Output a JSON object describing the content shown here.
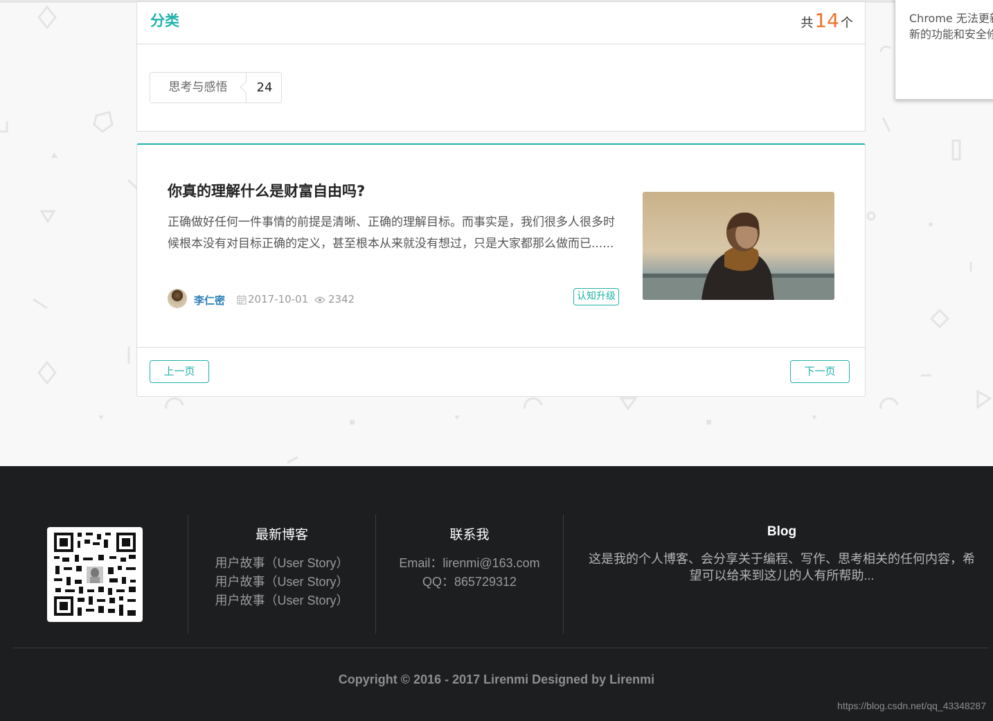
{
  "category": {
    "title": "分类",
    "count_prefix": "共",
    "count_value": "14",
    "count_suffix": "个",
    "tags": [
      {
        "label": "思考与感悟",
        "count": "24"
      }
    ]
  },
  "post": {
    "title": "你真的理解什么是财富自由吗?",
    "excerpt": "正确做好任何一件事情的前提是清晰、正确的理解目标。而事实是，我们很多人很多时候根本没有对目标正确的定义，甚至根本从来就没有想过，只是大家都那么做而已......",
    "author": "李仁密",
    "date": "2017-10-01",
    "views": "2342",
    "tag": "认知升级"
  },
  "pager": {
    "prev_label": "上一页",
    "next_label": "下一页"
  },
  "chrome_popup": {
    "line1": "Chrome 无法更新",
    "line2": "新的功能和安全修"
  },
  "footer": {
    "latest": {
      "heading": "最新博客",
      "items": [
        "用户故事（User Story）",
        "用户故事（User Story）",
        "用户故事（User Story）"
      ]
    },
    "contact": {
      "heading": "联系我",
      "email": "Email：lirenmi@163.com",
      "qq": "QQ：865729312"
    },
    "blog": {
      "heading": "Blog",
      "line1": "这是我的个人博客、会分享关于编程、写作、思考相关的任何内容，希",
      "line2": "望可以给来到这儿的人有所帮助..."
    },
    "copyright": "Copyright © 2016 - 2017 Lirenmi Designed by Lirenmi",
    "watermark": "https://blog.csdn.net/qq_43348287"
  },
  "colors": {
    "accent": "#20b2aa",
    "count_highlight": "#f0722a",
    "author_link": "#2a7fb8",
    "footer_bg": "#1d1e20"
  }
}
